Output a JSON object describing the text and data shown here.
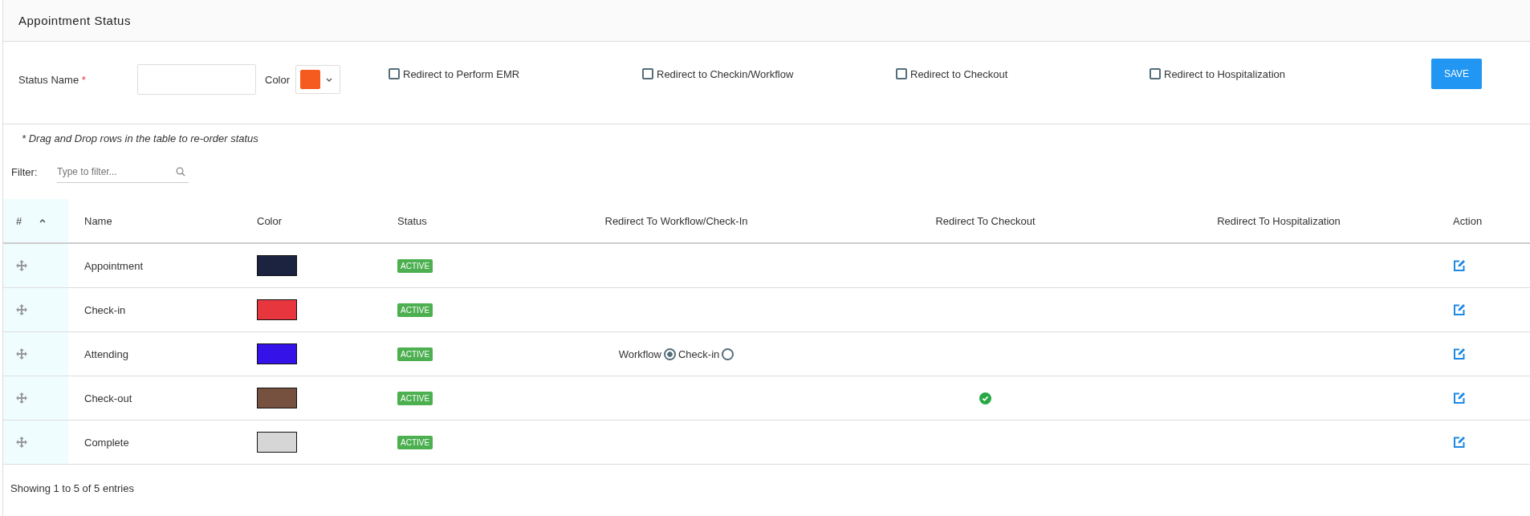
{
  "title": "Appointment Status",
  "form": {
    "status_name_label": "Status Name",
    "required_mark": "*",
    "color_label": "Color",
    "color_picker": {
      "color": "#f55a1f"
    },
    "checkboxes": [
      {
        "label": "Redirect to Perform EMR",
        "checked": false
      },
      {
        "label": "Redirect to Checkin/Workflow",
        "checked": false
      },
      {
        "label": "Redirect to Checkout",
        "checked": false
      },
      {
        "label": "Redirect to Hospitalization",
        "checked": false
      }
    ],
    "save_button": "SAVE"
  },
  "note": "* Drag and Drop rows in the table to re-order status",
  "filter": {
    "label": "Filter:",
    "placeholder": "Type to filter..."
  },
  "table": {
    "columns": [
      "#",
      "Name",
      "Color",
      "Status",
      "Redirect To Workflow/Check-In",
      "Redirect To Checkout",
      "Redirect To Hospitalization",
      "Action"
    ],
    "rows": [
      {
        "name": "Appointment",
        "color": "#1c2340",
        "status": "ACTIVE",
        "redirect_checkout": false
      },
      {
        "name": "Check-in",
        "color": "#e8363f",
        "status": "ACTIVE",
        "redirect_checkout": false
      },
      {
        "name": "Attending",
        "color": "#3412e8",
        "status": "ACTIVE",
        "redirect_checkout": false,
        "redirect_workflow": [
          {
            "label": "Workflow",
            "selected": true
          },
          {
            "label": "Check-in",
            "selected": false
          }
        ]
      },
      {
        "name": "Check-out",
        "color": "#77513f",
        "status": "ACTIVE",
        "redirect_checkout": true
      },
      {
        "name": "Complete",
        "color": "#d6d6d6",
        "status": "ACTIVE",
        "redirect_checkout": false
      }
    ]
  },
  "footer": "Showing 1 to 5 of 5 entries"
}
